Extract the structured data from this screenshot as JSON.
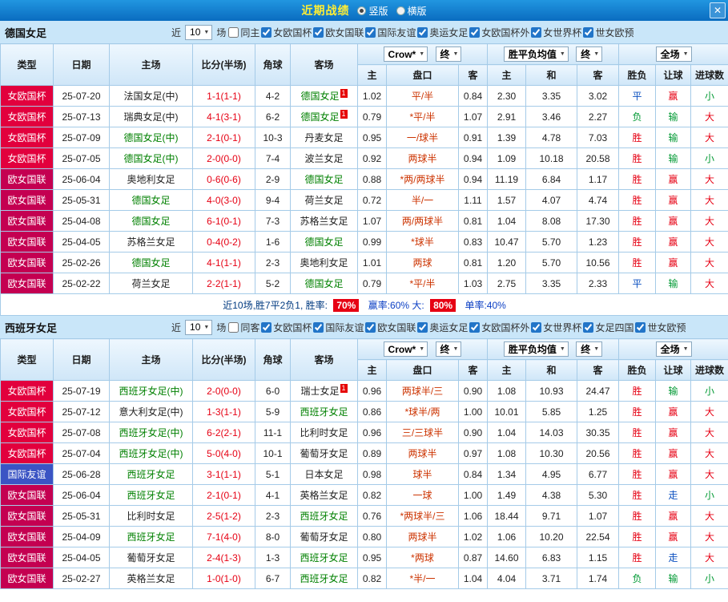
{
  "titlebar": {
    "title": "近期战绩",
    "options": [
      {
        "label": "竖版",
        "selected": true
      },
      {
        "label": "横版",
        "selected": false
      }
    ],
    "close_glyph": "✕"
  },
  "labels": {
    "near": "近",
    "matches": "场"
  },
  "headers": {
    "type": "类型",
    "date": "日期",
    "home": "主场",
    "score": "比分(半场)",
    "corners": "角球",
    "away": "客场",
    "company": "Crow*",
    "final": "终",
    "avg": "胜平负均值",
    "full": "全场",
    "home_s": "主",
    "handicap": "盘口",
    "away_s": "客",
    "draw_s": "和",
    "result": "胜负",
    "handicap_result": "让球",
    "goals": "进球数"
  },
  "colors": {
    "cup_red": "#e2003d",
    "league_red": "#c40051",
    "friendly_blue": "#3b54c4",
    "focus_green": "#008000",
    "score_red": "#e60013",
    "titlebar_blue": "#0a6cc0",
    "title_yellow": "#ffee33"
  },
  "sections": [
    {
      "team": "德国女足",
      "match_count": "10",
      "same_filter": {
        "label": "同主",
        "checked": false
      },
      "filters": [
        {
          "label": "女欧国杯",
          "checked": true
        },
        {
          "label": "欧女国联",
          "checked": true
        },
        {
          "label": "国际友谊",
          "checked": true
        },
        {
          "label": "奥运女足",
          "checked": true
        },
        {
          "label": "女欧国杯外",
          "checked": true
        },
        {
          "label": "女世界杯",
          "checked": true
        },
        {
          "label": "世女欧预",
          "checked": true
        }
      ],
      "rows": [
        {
          "type": "女欧国杯",
          "date": "25-07-20",
          "home": "法国女足(中)",
          "home_focus": false,
          "score": "1-1(1-1)",
          "corners": "4-2",
          "away": "德国女足",
          "away_focus": true,
          "away_card": "1",
          "odds_home": "1.02",
          "handicap": "平/半",
          "odds_away": "0.84",
          "avg_home": "2.30",
          "avg_draw": "3.35",
          "avg_away": "3.02",
          "result": "平",
          "handicap_result": "赢",
          "goals": "小"
        },
        {
          "type": "女欧国杯",
          "date": "25-07-13",
          "home": "瑞典女足(中)",
          "home_focus": false,
          "score": "4-1(3-1)",
          "corners": "6-2",
          "away": "德国女足",
          "away_focus": true,
          "away_card": "1",
          "odds_home": "0.79",
          "handicap": "*平/半",
          "odds_away": "1.07",
          "avg_home": "2.91",
          "avg_draw": "3.46",
          "avg_away": "2.27",
          "result": "负",
          "handicap_result": "输",
          "goals": "大"
        },
        {
          "type": "女欧国杯",
          "date": "25-07-09",
          "home": "德国女足(中)",
          "home_focus": true,
          "score": "2-1(0-1)",
          "corners": "10-3",
          "away": "丹麦女足",
          "away_focus": false,
          "odds_home": "0.95",
          "handicap": "一/球半",
          "odds_away": "0.91",
          "avg_home": "1.39",
          "avg_draw": "4.78",
          "avg_away": "7.03",
          "result": "胜",
          "handicap_result": "输",
          "goals": "大"
        },
        {
          "type": "女欧国杯",
          "date": "25-07-05",
          "home": "德国女足(中)",
          "home_focus": true,
          "score": "2-0(0-0)",
          "corners": "7-4",
          "away": "波兰女足",
          "away_focus": false,
          "odds_home": "0.92",
          "handicap": "两球半",
          "odds_away": "0.94",
          "avg_home": "1.09",
          "avg_draw": "10.18",
          "avg_away": "20.58",
          "result": "胜",
          "handicap_result": "输",
          "goals": "小"
        },
        {
          "type": "欧女国联",
          "date": "25-06-04",
          "home": "奥地利女足",
          "home_focus": false,
          "score": "0-6(0-6)",
          "corners": "2-9",
          "away": "德国女足",
          "away_focus": true,
          "odds_home": "0.88",
          "handicap": "*两/两球半",
          "odds_away": "0.94",
          "avg_home": "11.19",
          "avg_draw": "6.84",
          "avg_away": "1.17",
          "result": "胜",
          "handicap_result": "赢",
          "goals": "大"
        },
        {
          "type": "欧女国联",
          "date": "25-05-31",
          "home": "德国女足",
          "home_focus": true,
          "score": "4-0(3-0)",
          "corners": "9-4",
          "away": "荷兰女足",
          "away_focus": false,
          "odds_home": "0.72",
          "handicap": "半/一",
          "odds_away": "1.11",
          "avg_home": "1.57",
          "avg_draw": "4.07",
          "avg_away": "4.74",
          "result": "胜",
          "handicap_result": "赢",
          "goals": "大"
        },
        {
          "type": "欧女国联",
          "date": "25-04-08",
          "home": "德国女足",
          "home_focus": true,
          "score": "6-1(0-1)",
          "corners": "7-3",
          "away": "苏格兰女足",
          "away_focus": false,
          "odds_home": "1.07",
          "handicap": "两/两球半",
          "odds_away": "0.81",
          "avg_home": "1.04",
          "avg_draw": "8.08",
          "avg_away": "17.30",
          "result": "胜",
          "handicap_result": "赢",
          "goals": "大"
        },
        {
          "type": "欧女国联",
          "date": "25-04-05",
          "home": "苏格兰女足",
          "home_focus": false,
          "score": "0-4(0-2)",
          "corners": "1-6",
          "away": "德国女足",
          "away_focus": true,
          "odds_home": "0.99",
          "handicap": "*球半",
          "odds_away": "0.83",
          "avg_home": "10.47",
          "avg_draw": "5.70",
          "avg_away": "1.23",
          "result": "胜",
          "handicap_result": "赢",
          "goals": "大"
        },
        {
          "type": "欧女国联",
          "date": "25-02-26",
          "home": "德国女足",
          "home_focus": true,
          "score": "4-1(1-1)",
          "corners": "2-3",
          "away": "奥地利女足",
          "away_focus": false,
          "odds_home": "1.01",
          "handicap": "两球",
          "odds_away": "0.81",
          "avg_home": "1.20",
          "avg_draw": "5.70",
          "avg_away": "10.56",
          "result": "胜",
          "handicap_result": "赢",
          "goals": "大"
        },
        {
          "type": "欧女国联",
          "date": "25-02-22",
          "home": "荷兰女足",
          "home_focus": false,
          "score": "2-2(1-1)",
          "corners": "5-2",
          "away": "德国女足",
          "away_focus": true,
          "odds_home": "0.79",
          "handicap": "*平/半",
          "odds_away": "1.03",
          "avg_home": "2.75",
          "avg_draw": "3.35",
          "avg_away": "2.33",
          "result": "平",
          "handicap_result": "输",
          "goals": "大"
        }
      ],
      "summary": {
        "record": "近10场,胜7平2负1, 胜率:",
        "win_rate": "70%",
        "mid": "赢率:60%  大:",
        "big_rate": "80%",
        "tail": "单率:40%"
      }
    },
    {
      "team": "西班牙女足",
      "match_count": "10",
      "same_filter": {
        "label": "同客",
        "checked": false
      },
      "filters": [
        {
          "label": "女欧国杯",
          "checked": true
        },
        {
          "label": "国际友谊",
          "checked": true
        },
        {
          "label": "欧女国联",
          "checked": true
        },
        {
          "label": "奥运女足",
          "checked": true
        },
        {
          "label": "女欧国杯外",
          "checked": true
        },
        {
          "label": "女世界杯",
          "checked": true
        },
        {
          "label": "女足四国",
          "checked": true
        },
        {
          "label": "世女欧预",
          "checked": true
        }
      ],
      "rows": [
        {
          "type": "女欧国杯",
          "date": "25-07-19",
          "home": "西班牙女足(中)",
          "home_focus": true,
          "score": "2-0(0-0)",
          "corners": "6-0",
          "away": "瑞士女足",
          "away_focus": false,
          "away_card": "1",
          "odds_home": "0.96",
          "handicap": "两球半/三",
          "odds_away": "0.90",
          "avg_home": "1.08",
          "avg_draw": "10.93",
          "avg_away": "24.47",
          "result": "胜",
          "handicap_result": "输",
          "goals": "小"
        },
        {
          "type": "女欧国杯",
          "date": "25-07-12",
          "home": "意大利女足(中)",
          "home_focus": false,
          "score": "1-3(1-1)",
          "corners": "5-9",
          "away": "西班牙女足",
          "away_focus": true,
          "odds_home": "0.86",
          "handicap": "*球半/两",
          "odds_away": "1.00",
          "avg_home": "10.01",
          "avg_draw": "5.85",
          "avg_away": "1.25",
          "result": "胜",
          "handicap_result": "赢",
          "goals": "大"
        },
        {
          "type": "女欧国杯",
          "date": "25-07-08",
          "home": "西班牙女足(中)",
          "home_focus": true,
          "score": "6-2(2-1)",
          "corners": "11-1",
          "away": "比利时女足",
          "away_focus": false,
          "odds_home": "0.96",
          "handicap": "三/三球半",
          "odds_away": "0.90",
          "avg_home": "1.04",
          "avg_draw": "14.03",
          "avg_away": "30.35",
          "result": "胜",
          "handicap_result": "赢",
          "goals": "大"
        },
        {
          "type": "女欧国杯",
          "date": "25-07-04",
          "home": "西班牙女足(中)",
          "home_focus": true,
          "score": "5-0(4-0)",
          "corners": "10-1",
          "away": "葡萄牙女足",
          "away_focus": false,
          "odds_home": "0.89",
          "handicap": "两球半",
          "odds_away": "0.97",
          "avg_home": "1.08",
          "avg_draw": "10.30",
          "avg_away": "20.56",
          "result": "胜",
          "handicap_result": "赢",
          "goals": "大"
        },
        {
          "type": "国际友谊",
          "date": "25-06-28",
          "home": "西班牙女足",
          "home_focus": true,
          "score": "3-1(1-1)",
          "corners": "5-1",
          "away": "日本女足",
          "away_focus": false,
          "odds_home": "0.98",
          "handicap": "球半",
          "odds_away": "0.84",
          "avg_home": "1.34",
          "avg_draw": "4.95",
          "avg_away": "6.77",
          "result": "胜",
          "handicap_result": "赢",
          "goals": "大"
        },
        {
          "type": "欧女国联",
          "date": "25-06-04",
          "home": "西班牙女足",
          "home_focus": true,
          "score": "2-1(0-1)",
          "corners": "4-1",
          "away": "英格兰女足",
          "away_focus": false,
          "odds_home": "0.82",
          "handicap": "一球",
          "odds_away": "1.00",
          "avg_home": "1.49",
          "avg_draw": "4.38",
          "avg_away": "5.30",
          "result": "胜",
          "handicap_result": "走",
          "goals": "小"
        },
        {
          "type": "欧女国联",
          "date": "25-05-31",
          "home": "比利时女足",
          "home_focus": false,
          "score": "2-5(1-2)",
          "corners": "2-3",
          "away": "西班牙女足",
          "away_focus": true,
          "odds_home": "0.76",
          "handicap": "*两球半/三",
          "odds_away": "1.06",
          "avg_home": "18.44",
          "avg_draw": "9.71",
          "avg_away": "1.07",
          "result": "胜",
          "handicap_result": "赢",
          "goals": "大"
        },
        {
          "type": "欧女国联",
          "date": "25-04-09",
          "home": "西班牙女足",
          "home_focus": true,
          "score": "7-1(4-0)",
          "corners": "8-0",
          "away": "葡萄牙女足",
          "away_focus": false,
          "odds_home": "0.80",
          "handicap": "两球半",
          "odds_away": "1.02",
          "avg_home": "1.06",
          "avg_draw": "10.20",
          "avg_away": "22.54",
          "result": "胜",
          "handicap_result": "赢",
          "goals": "大"
        },
        {
          "type": "欧女国联",
          "date": "25-04-05",
          "home": "葡萄牙女足",
          "home_focus": false,
          "score": "2-4(1-3)",
          "corners": "1-3",
          "away": "西班牙女足",
          "away_focus": true,
          "odds_home": "0.95",
          "handicap": "*两球",
          "odds_away": "0.87",
          "avg_home": "14.60",
          "avg_draw": "6.83",
          "avg_away": "1.15",
          "result": "胜",
          "handicap_result": "走",
          "goals": "大"
        },
        {
          "type": "欧女国联",
          "date": "25-02-27",
          "home": "英格兰女足",
          "home_focus": false,
          "score": "1-0(1-0)",
          "corners": "6-7",
          "away": "西班牙女足",
          "away_focus": true,
          "odds_home": "0.82",
          "handicap": "*半/一",
          "odds_away": "1.04",
          "avg_home": "4.04",
          "avg_draw": "3.71",
          "avg_away": "1.74",
          "result": "负",
          "handicap_result": "输",
          "goals": "小"
        }
      ]
    }
  ]
}
